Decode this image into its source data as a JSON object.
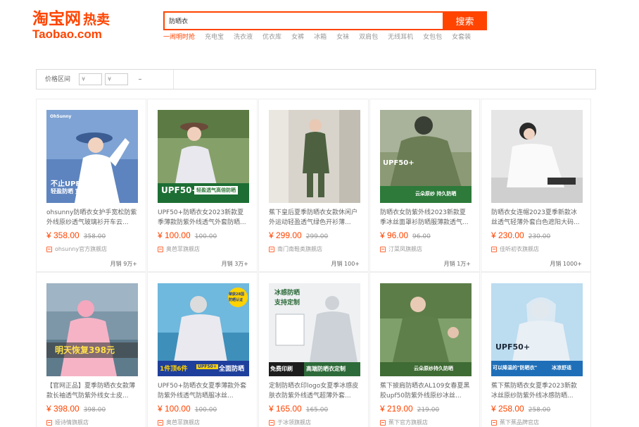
{
  "logo": {
    "main": "淘宝网",
    "sub": "热卖",
    "en": "Taobao.com"
  },
  "search": {
    "query": "防晒衣",
    "button": "搜索"
  },
  "hot_words": [
    "一闹明时抢",
    "充电宝",
    "洗衣液",
    "优衣库",
    "女裤",
    "冰箱",
    "女袜",
    "双肩包",
    "无线耳机",
    "女包包",
    "女套装"
  ],
  "filter": {
    "label": "价格区间",
    "min_placeholder": "¥",
    "max_placeholder": "¥"
  },
  "products": [
    {
      "title": "ohsunny防晒衣女护手宽松防紫外线原纱透气玻璃衫开车云...",
      "price": "¥ 358.00",
      "orig": "358.00",
      "shop": "ohsunny官方旗舰店",
      "sales": "月销 9万+",
      "img_text": [
        "OhSunny",
        "不止UPF50+",
        "轻盈防晒 宽松透气"
      ],
      "colors": {
        "bg": "#6b8fc4",
        "accent": "#2c4e86"
      }
    },
    {
      "title": "UPF50+防晒衣女2023新款夏季薄款防紫外线透气外套防晒...",
      "price": "¥ 100.00",
      "orig": "100.00",
      "shop": "奥芭菲旗舰店",
      "sales": "月销 3万+",
      "img_text": [
        "UPF50+",
        "轻盈透气高倍防晒"
      ],
      "colors": {
        "bg": "#6d8b55",
        "accent": "#2f7a3a"
      }
    },
    {
      "title": "蕉下皇后夏季防晒衣女款休闲户外运动轻盈透气绿色开衫薄...",
      "price": "¥ 299.00",
      "orig": "299.00",
      "shop": "南门南鞋类旗舰店",
      "sales": "月销 100+",
      "img_text": [],
      "colors": {
        "bg": "#c9c4ba",
        "accent": "#4b5e3b"
      }
    },
    {
      "title": "防晒衣女防紫外线2023新款夏季冰丝面罩衫防晒服薄款透气...",
      "price": "¥ 96.00",
      "orig": "96.00",
      "shop": "汀菜凤旗舰店",
      "sales": "月销 1万+",
      "img_text": [
        "UPF50+",
        "云朵原纱 持久防晒"
      ],
      "colors": {
        "bg": "#9aa38b",
        "accent": "#5a6b45"
      }
    },
    {
      "title": "防晒衣女连帽2023夏季新款冰丝透气轻薄外套白色遮阳大码...",
      "price": "¥ 230.00",
      "orig": "230.00",
      "shop": "佳听初衣旗舰店",
      "sales": "月销 1000+",
      "img_text": [],
      "colors": {
        "bg": "#d9d9d9",
        "accent": "#f2f2f2"
      }
    },
    {
      "title": "【官网正品】夏季防晒衣女款薄款长袖透气防紫外线女士皮...",
      "price": "¥ 398.00",
      "orig": "398.00",
      "shop": "娅诗情旗舰店",
      "sales": "",
      "img_text": [
        "明天恢复398元"
      ],
      "colors": {
        "bg": "#8da6b8",
        "accent": "#f3a1b8"
      }
    },
    {
      "title": "UPF50+防晒衣女夏季薄款外套防紫外线透气防晒服冰丝...",
      "price": "¥ 100.00",
      "orig": "100.00",
      "shop": "奥芭菲旗舰店",
      "sales": "",
      "img_text": [
        "荣获28国",
        "防晒认证",
        "1件顶6件",
        "UPF50+",
        "全面防晒"
      ],
      "colors": {
        "bg": "#4a9fc8",
        "accent": "#1e3f9c"
      }
    },
    {
      "title": "定制防晒衣印logo女夏季冰感皮肤衣防紫外线透气超薄外套...",
      "price": "¥ 165.00",
      "orig": "165.00",
      "shop": "于冰领旗舰店",
      "sales": "",
      "img_text": [
        "冰感防晒",
        "支持定制",
        "免费印刷",
        "高端防晒衣定制"
      ],
      "colors": {
        "bg": "#e3e6ea",
        "accent": "#2e6b3a"
      }
    },
    {
      "title": "蕉下披肩防晒衣AL109女春夏黑胶upf50防紫外线原纱冰丝...",
      "price": "¥ 219.00",
      "orig": "219.00",
      "shop": "蕉下官方旗舰店",
      "sales": "",
      "img_text": [
        "云朵原纱持久防晒"
      ],
      "colors": {
        "bg": "#5e7e4a",
        "accent": "#3f5a2f"
      }
    },
    {
      "title": "蕉下蕉防晒衣女夏季2023新款冰丝原纱防紫外线冰感防晒...",
      "price": "¥ 258.00",
      "orig": "258.00",
      "shop": "蕉下蕉品牌官店",
      "sales": "",
      "img_text": [
        "UPF50+",
        "可以降温的\"防晒衣\"",
        "冰凉舒适"
      ],
      "colors": {
        "bg": "#9ec7e6",
        "accent": "#1f6fb8"
      }
    }
  ]
}
